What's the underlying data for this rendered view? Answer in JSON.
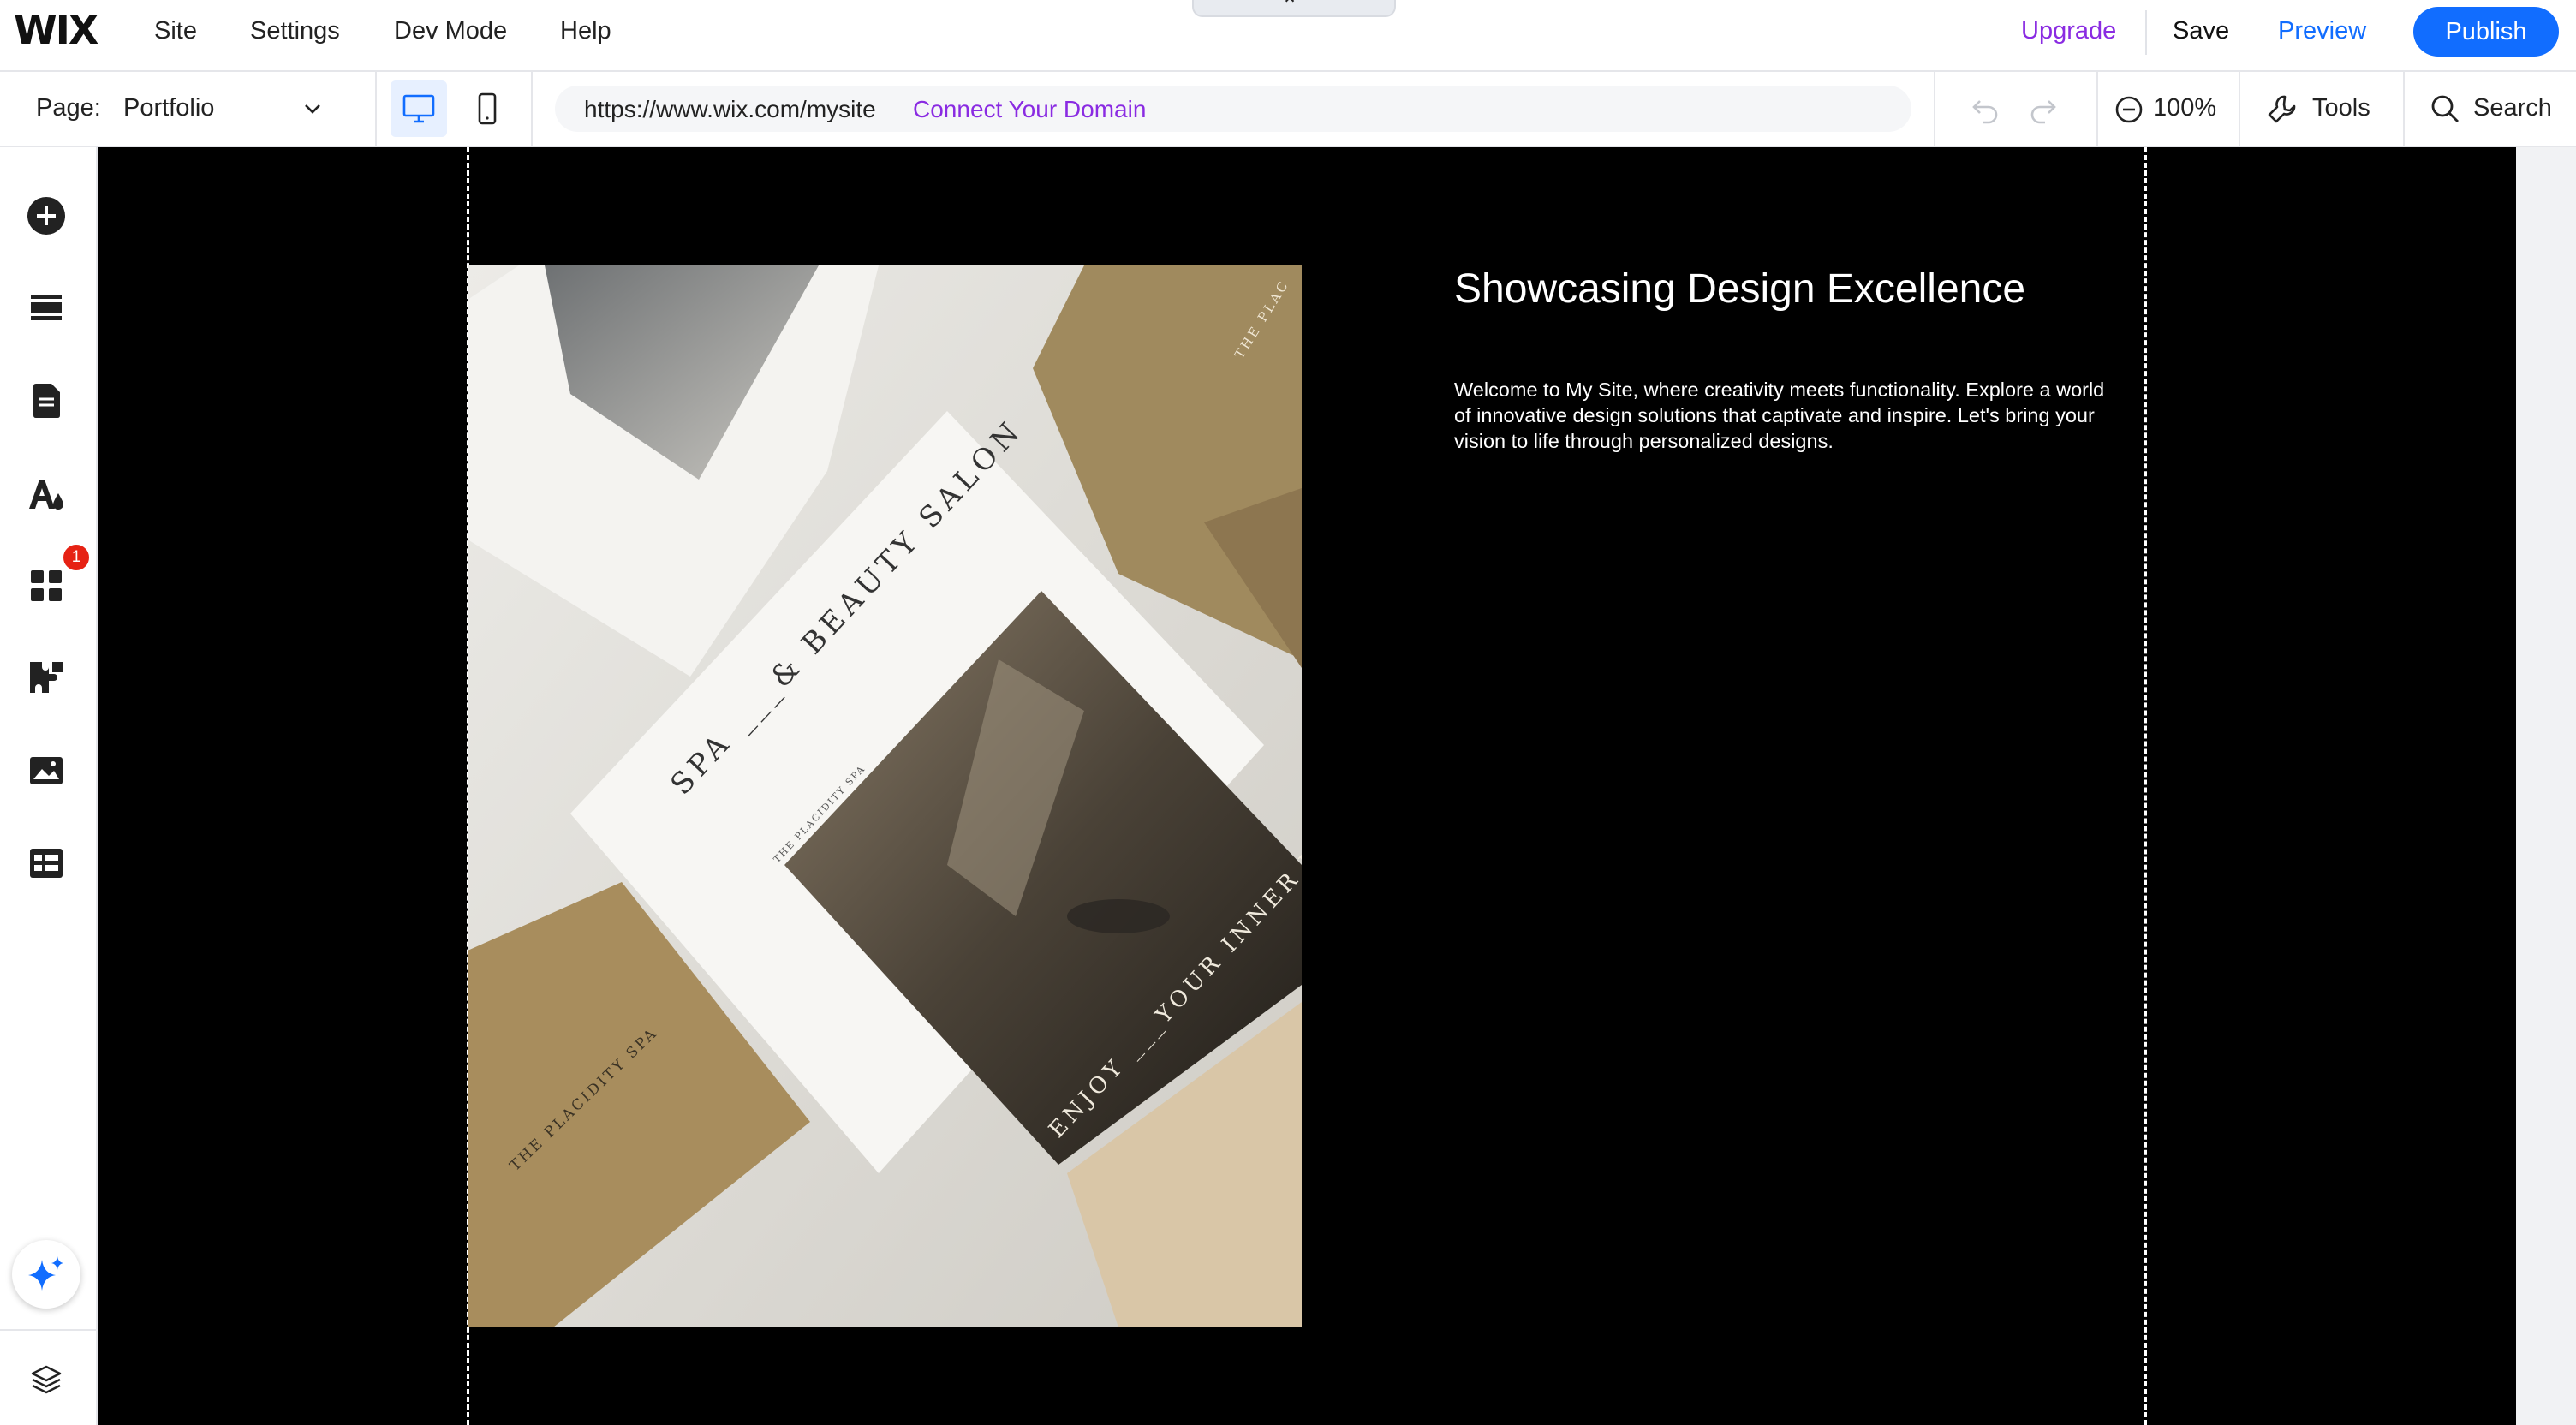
{
  "app": {
    "logo": "WIX"
  },
  "topbar": {
    "menu": [
      "Site",
      "Settings",
      "Dev Mode",
      "Help"
    ],
    "upgrade": "Upgrade",
    "save": "Save",
    "preview": "Preview",
    "publish": "Publish"
  },
  "subbar": {
    "page_label": "Page:",
    "page_name": "Portfolio",
    "url": "https://www.wix.com/mysite",
    "connect_domain": "Connect Your Domain",
    "zoom": "100%",
    "tools": "Tools",
    "search": "Search"
  },
  "sidebar": {
    "items": [
      {
        "icon": "add-icon"
      },
      {
        "icon": "sections-icon"
      },
      {
        "icon": "pages-icon"
      },
      {
        "icon": "theme-icon"
      },
      {
        "icon": "apps-icon"
      },
      {
        "icon": "plugins-icon"
      },
      {
        "icon": "media-icon"
      },
      {
        "icon": "cms-icon"
      }
    ],
    "apps_badge": "1",
    "ai_icon": "sparkle-icon",
    "layers_icon": "layers-icon"
  },
  "canvas": {
    "heading": "Showcasing Design Excellence",
    "body": "Welcome to My Site, where creativity meets functionality. Explore a world of innovative design solutions that captivate and inspire. Let's bring your vision to life through personalized designs.",
    "image_text": {
      "salon": "SPA ___& BEAUTY SALON",
      "small1": "THE PLACIDITY SPA",
      "enjoy": "ENJOY ___YOUR INNER PE",
      "card": "THE PLACIDITY SPA",
      "corner": "THE PLAC"
    }
  },
  "colors": {
    "accent": "#116dff",
    "upgrade": "#8a2be2",
    "badge": "#e62214",
    "canvas": "#000000"
  }
}
